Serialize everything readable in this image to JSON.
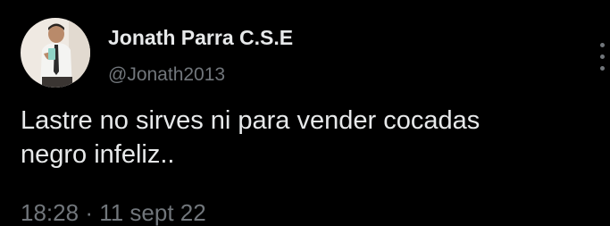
{
  "tweet": {
    "author": {
      "display_name": "Jonath Parra C.S.E",
      "handle": "@Jonath2013",
      "avatar_icon": "profile-photo"
    },
    "text": "Lastre no sirves ni para vender cocadas\nnegro infeliz..",
    "time": "18:28",
    "separator": "·",
    "date": "11 sept 22",
    "more_icon": "more-vertical-icon"
  },
  "colors": {
    "background": "#000000",
    "primary_text": "#e7e9ea",
    "secondary_text": "#71767b"
  }
}
